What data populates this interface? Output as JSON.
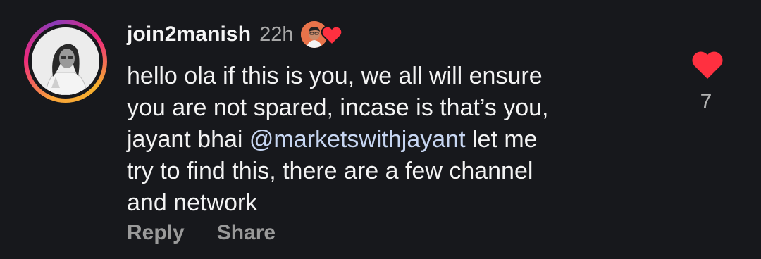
{
  "comment": {
    "username": "join2manish",
    "timestamp": "22h",
    "lines": [
      "hello ola if this is you, we all will ensure",
      "you are not spared, incase is that’s you,",
      "jayant bhai ",
      "@marketswithjayant",
      " let me",
      "try to find this, there are a few channel",
      "and network"
    ],
    "like_count": "7"
  },
  "actions": {
    "reply_label": "Reply",
    "share_label": "Share"
  },
  "icons": {
    "like": "heart-icon",
    "author_liked": "author-liked-heart-icon"
  },
  "colors": {
    "background": "#17181c",
    "heart": "#ff3040",
    "mention": "#c7d6f2",
    "muted": "#9a9a9a"
  }
}
